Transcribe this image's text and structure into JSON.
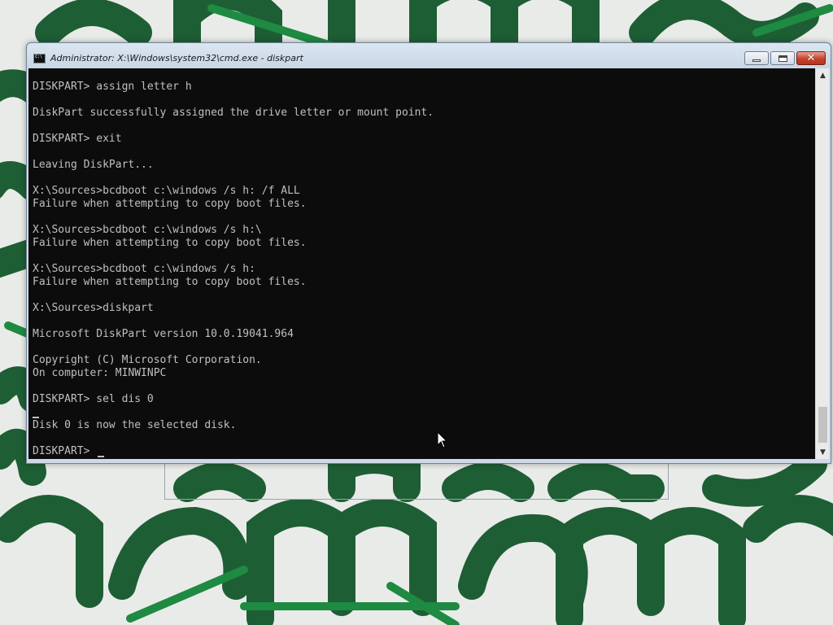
{
  "window": {
    "title": "Administrator: X:\\Windows\\system32\\cmd.exe - diskpart",
    "close_symbol": "✕"
  },
  "icons": {
    "title": "cmd-icon",
    "minimize": "minimize-icon",
    "maximize": "maximize-icon",
    "close": "close-icon",
    "scroll_up": "▲",
    "scroll_down": "▼"
  },
  "console": {
    "text": "DISKPART> assign letter h\n\nDiskPart successfully assigned the drive letter or mount point.\n\nDISKPART> exit\n\nLeaving DiskPart...\n\nX:\\Sources>bcdboot c:\\windows /s h: /f ALL\nFailure when attempting to copy boot files.\n\nX:\\Sources>bcdboot c:\\windows /s h:\\\nFailure when attempting to copy boot files.\n\nX:\\Sources>bcdboot c:\\windows /s h:\nFailure when attempting to copy boot files.\n\nX:\\Sources>diskpart\n\nMicrosoft DiskPart version 10.0.19041.964\n\nCopyright (C) Microsoft Corporation.\nOn computer: MINWINPC\n\nDISKPART> sel dis 0\n\nDisk 0 is now the selected disk.\n\nDISKPART> "
  },
  "colors": {
    "console_bg": "#0c0c0c",
    "console_fg": "#c0c0c0",
    "wallpaper_green": "#1e5e34",
    "wallpaper_light": "#e9ebe9"
  }
}
